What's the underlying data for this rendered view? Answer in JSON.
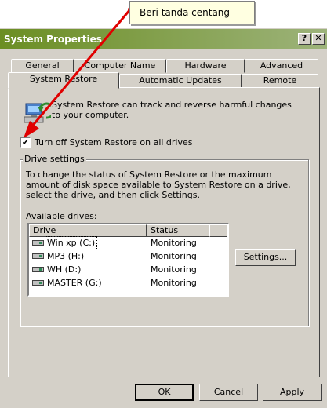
{
  "callout": {
    "text": "Beri tanda centang"
  },
  "window": {
    "title": "System Properties",
    "help_label": "?",
    "close_label": "✕"
  },
  "tabs_back": [
    {
      "label": "General"
    },
    {
      "label": "Computer Name"
    },
    {
      "label": "Hardware"
    },
    {
      "label": "Advanced"
    }
  ],
  "tabs_front": [
    {
      "label": "System Restore"
    },
    {
      "label": "Automatic Updates"
    },
    {
      "label": "Remote"
    }
  ],
  "intro": "System Restore can track and reverse harmful changes to your computer.",
  "turn_off": {
    "label": "Turn off System Restore on all drives",
    "checked": true,
    "mark": "✔"
  },
  "drive_settings": {
    "title": "Drive settings",
    "description": "To change the status of System Restore or the maximum amount of disk space available to System Restore on a drive, select the drive, and then click Settings.",
    "available_label": "Available drives:",
    "columns": {
      "drive": "Drive",
      "status": "Status"
    },
    "drives": [
      {
        "name": "Win xp (C:)",
        "status": "Monitoring"
      },
      {
        "name": "MP3 (H:)",
        "status": "Monitoring"
      },
      {
        "name": "WH (D:)",
        "status": "Monitoring"
      },
      {
        "name": "MASTER (G:)",
        "status": "Monitoring"
      }
    ],
    "settings_label": "Settings..."
  },
  "footer": {
    "ok": "OK",
    "cancel": "Cancel",
    "apply": "Apply"
  },
  "colors": {
    "titlebar": "#6b8e23",
    "face": "#d4d0c8",
    "arrow": "#e00000",
    "callout": "#ffffe1"
  }
}
